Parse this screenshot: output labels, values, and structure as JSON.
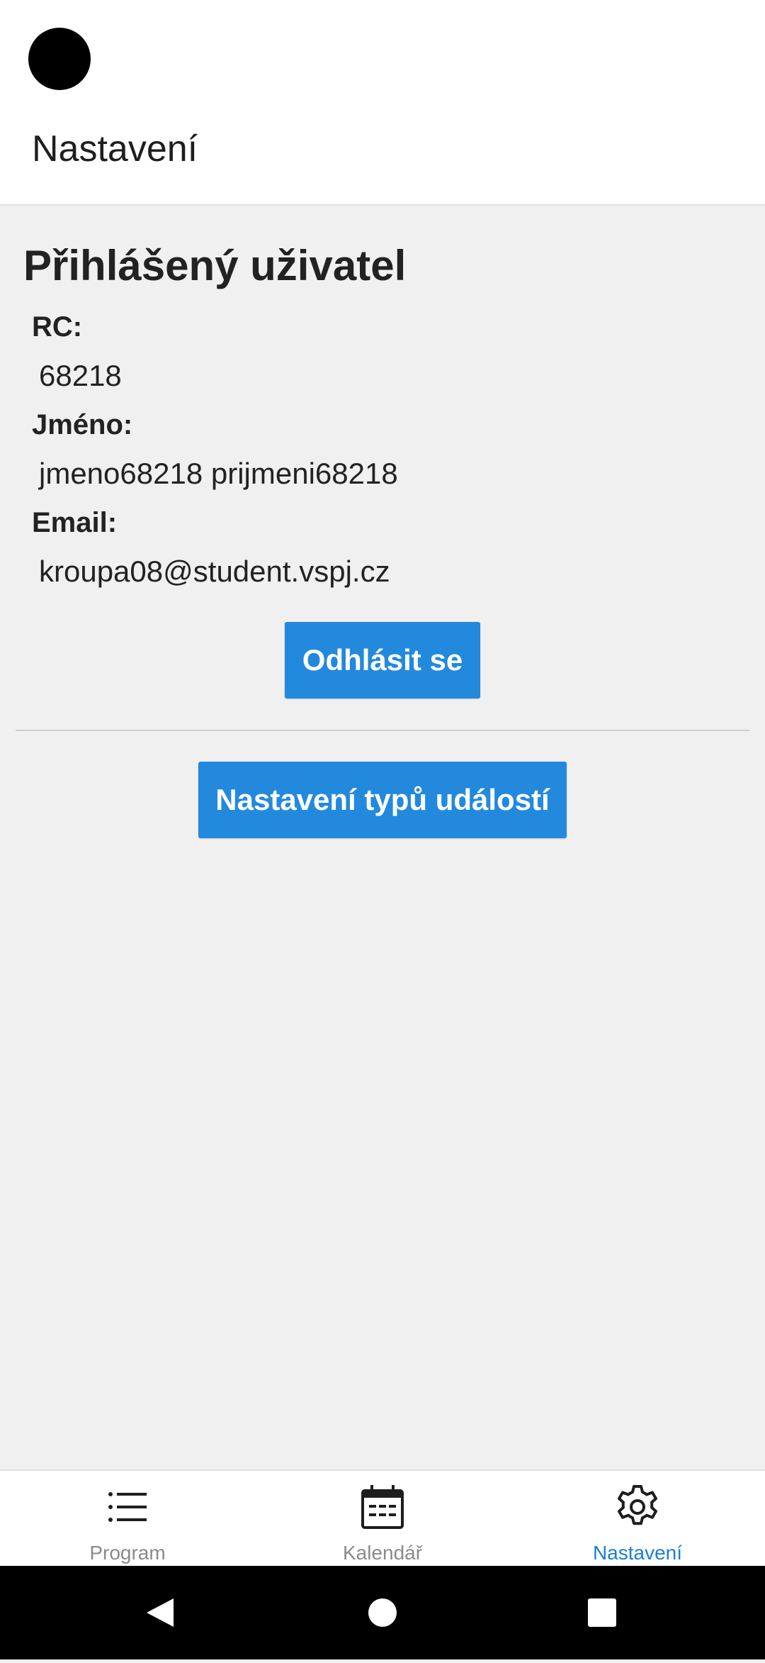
{
  "header": {
    "title": "Nastavení"
  },
  "user": {
    "section_title": "Přihlášený uživatel",
    "rc_label": "RC:",
    "rc_value": "68218",
    "name_label": "Jméno:",
    "name_value": "jmeno68218 prijmeni68218",
    "email_label": "Email:",
    "email_value": "kroupa08@student.vspj.cz"
  },
  "actions": {
    "logout_label": "Odhlásit se",
    "event_types_label": "Nastavení typů událostí"
  },
  "tabs": [
    {
      "label": "Program",
      "icon": "list-icon",
      "active": false
    },
    {
      "label": "Kalendář",
      "icon": "calendar-icon",
      "active": false
    },
    {
      "label": "Nastavení",
      "icon": "gear-icon",
      "active": true
    }
  ],
  "colors": {
    "accent": "#2389dd",
    "active_tab": "#1a7fd8",
    "inactive_tab": "#8a8a8a",
    "background": "#f0f0f0"
  }
}
